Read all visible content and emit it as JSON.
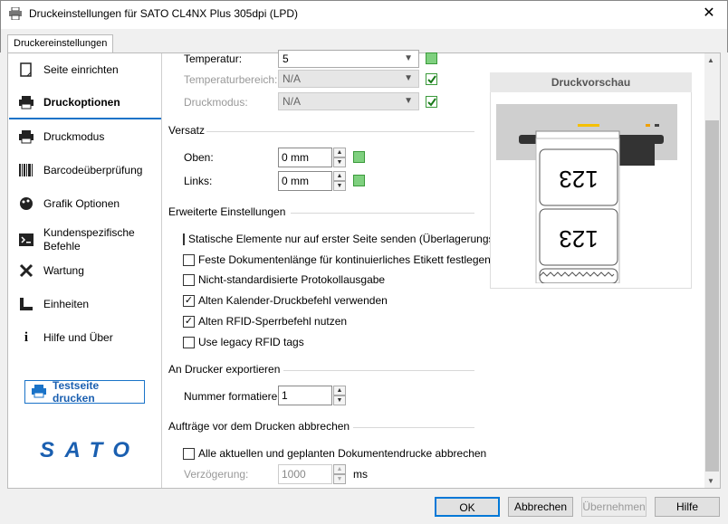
{
  "window": {
    "title": "Druckeinstellungen für SATO CL4NX Plus 305dpi (LPD)",
    "close": "✕"
  },
  "tab": {
    "label": "Druckereinstellungen"
  },
  "sidebar": {
    "items": [
      {
        "label": "Seite einrichten",
        "icon": "page-setup-icon"
      },
      {
        "label": "Druckoptionen",
        "icon": "printer-icon",
        "active": true
      },
      {
        "label": "Druckmodus",
        "icon": "print-mode-icon"
      },
      {
        "label": "Barcodeüberprüfung",
        "icon": "barcode-icon"
      },
      {
        "label": "Grafik Optionen",
        "icon": "graphics-icon"
      },
      {
        "label": "Kundenspezifische Befehle",
        "icon": "command-icon"
      },
      {
        "label": "Wartung",
        "icon": "wrench-icon"
      },
      {
        "label": "Einheiten",
        "icon": "ruler-icon"
      },
      {
        "label": "Hilfe und Über",
        "icon": "info-icon"
      }
    ],
    "test_button": "Testseite drucken",
    "logo": "SATO"
  },
  "temp": {
    "label": "Temperatur:",
    "value": "5",
    "range_label": "Temperaturbereich:",
    "range_value": "N/A",
    "mode_label": "Druckmodus:",
    "mode_value": "N/A"
  },
  "offset": {
    "section": "Versatz",
    "top_label": "Oben:",
    "top_value": "0 mm",
    "left_label": "Links:",
    "left_value": "0 mm"
  },
  "advanced": {
    "section": "Erweiterte Einstellungen",
    "options": [
      {
        "label": "Statische Elemente nur auf erster Seite senden (Überlagerungsfunktio",
        "checked": false
      },
      {
        "label": "Feste Dokumentenlänge für kontinuierliches Etikett festlegen",
        "checked": false
      },
      {
        "label": "Nicht-standardisierte Protokollausgabe",
        "checked": false
      },
      {
        "label": "Alten Kalender-Druckbefehl verwenden",
        "checked": true
      },
      {
        "label": "Alten RFID-Sperrbefehl nutzen",
        "checked": true
      },
      {
        "label": "Use legacy RFID tags",
        "checked": false
      }
    ]
  },
  "export": {
    "section": "An Drucker exportieren",
    "label": "Nummer formatieren:",
    "value": "1"
  },
  "cancel": {
    "section": "Aufträge vor dem Drucken abbrechen",
    "option": "Alle aktuellen und geplanten Dokumentendrucke abbrechen",
    "delay_label": "Verzögerung:",
    "delay_value": "1000",
    "unit": "ms"
  },
  "preview": {
    "title": "Druckvorschau",
    "label_text": "123"
  },
  "buttons": {
    "ok": "OK",
    "cancel": "Abbrechen",
    "apply": "Übernehmen",
    "help": "Hilfe"
  },
  "colors": {
    "accent": "#1a73c8",
    "green": "#3a9a3a"
  }
}
